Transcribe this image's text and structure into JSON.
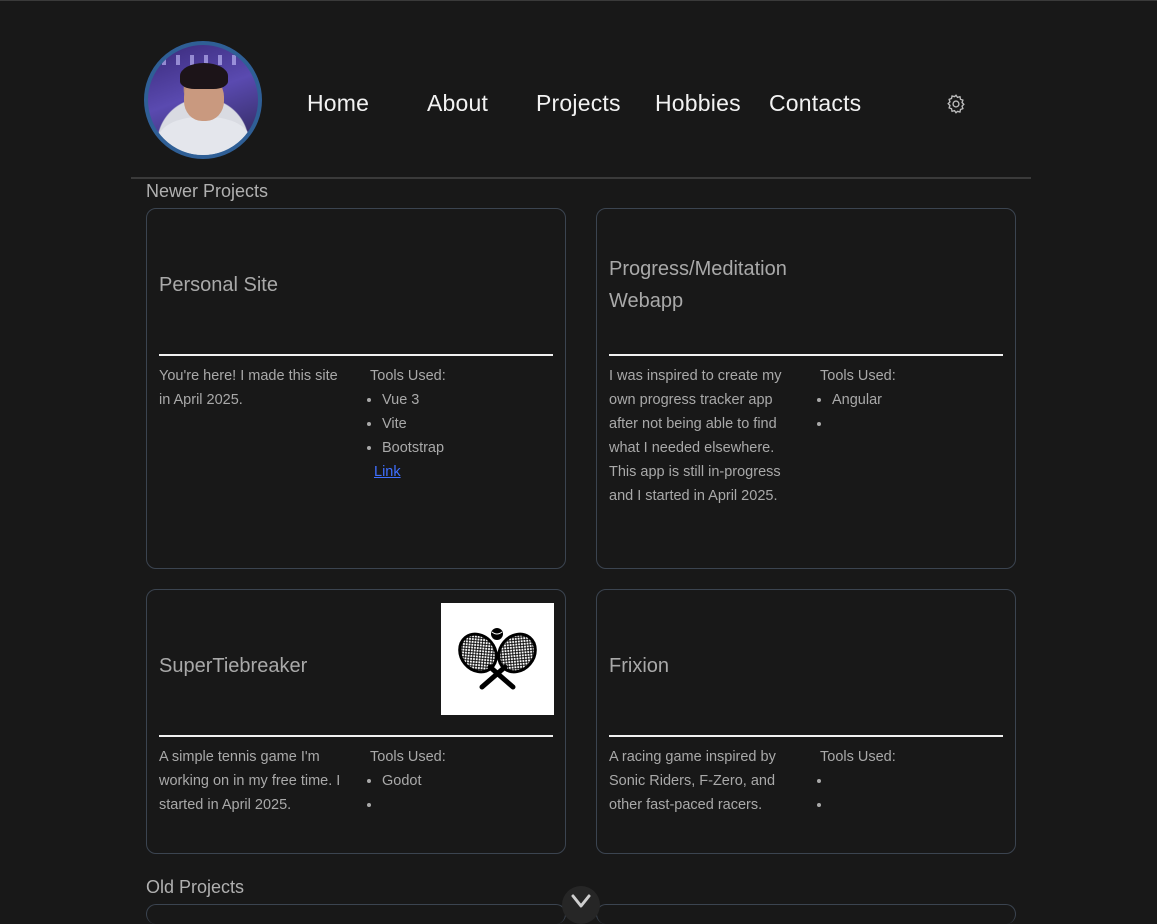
{
  "nav": {
    "items": [
      "Home",
      "About",
      "Projects",
      "Hobbies",
      "Contacts"
    ]
  },
  "icons": {
    "settings": "gear-icon",
    "scroll": "chevron-down-icon",
    "thumbnail": "crossed-tennis-rackets-icon"
  },
  "colors": {
    "background": "#181818",
    "card_border": "#3b4450",
    "link": "#3f6fff",
    "avatar_ring": "#2f5f96"
  },
  "sections": {
    "newer": "Newer Projects",
    "old": "Old Projects"
  },
  "tools_label": "Tools Used:",
  "projects": [
    {
      "title": "Personal Site",
      "description": "You're here! I made this site in April 2025.",
      "tools": [
        "Vue 3",
        "Vite",
        "Bootstrap"
      ],
      "link": "Link"
    },
    {
      "title": "Progress/Meditation Webapp",
      "description": "I was inspired to create my own progress tracker app after not being able to find what I needed elsewhere. This app is still in-progress and I started in April 2025.",
      "tools": [
        "Angular",
        ""
      ]
    },
    {
      "title": "SuperTiebreaker",
      "description": "A simple tennis game I'm working on in my free time. I started in April 2025.",
      "tools": [
        "Godot",
        ""
      ]
    },
    {
      "title": "Frixion",
      "description": "A racing game inspired by Sonic Riders, F-Zero, and other fast-paced racers.",
      "tools": [
        "",
        ""
      ]
    }
  ]
}
